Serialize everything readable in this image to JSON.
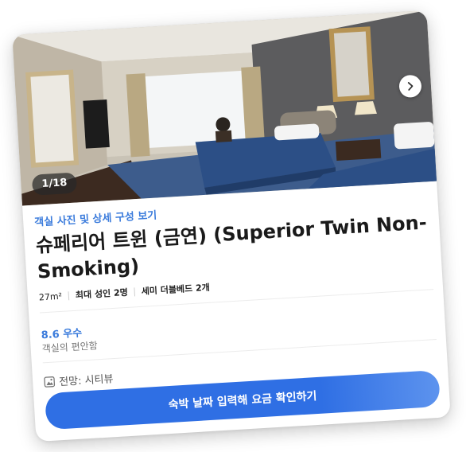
{
  "gallery": {
    "counter": "1/18",
    "next_icon": "chevron-right-icon",
    "photo_link": "객실 사진 및 상세 구성 보기"
  },
  "room": {
    "title": "슈페리어 트윈 (금연) (Superior Twin Non-Smoking)",
    "size": "27m²",
    "capacity": "최대 성인 2명",
    "beds": "세미 더블베드 2개"
  },
  "rating": {
    "score": "8.6",
    "label": "우수",
    "category": "객실의 편안함"
  },
  "view": {
    "icon": "view-icon",
    "text": "전망: 시티뷰"
  },
  "cta": {
    "label": "숙박 날짜 입력해 요금 확인하기",
    "color": "#2f6fe4"
  }
}
